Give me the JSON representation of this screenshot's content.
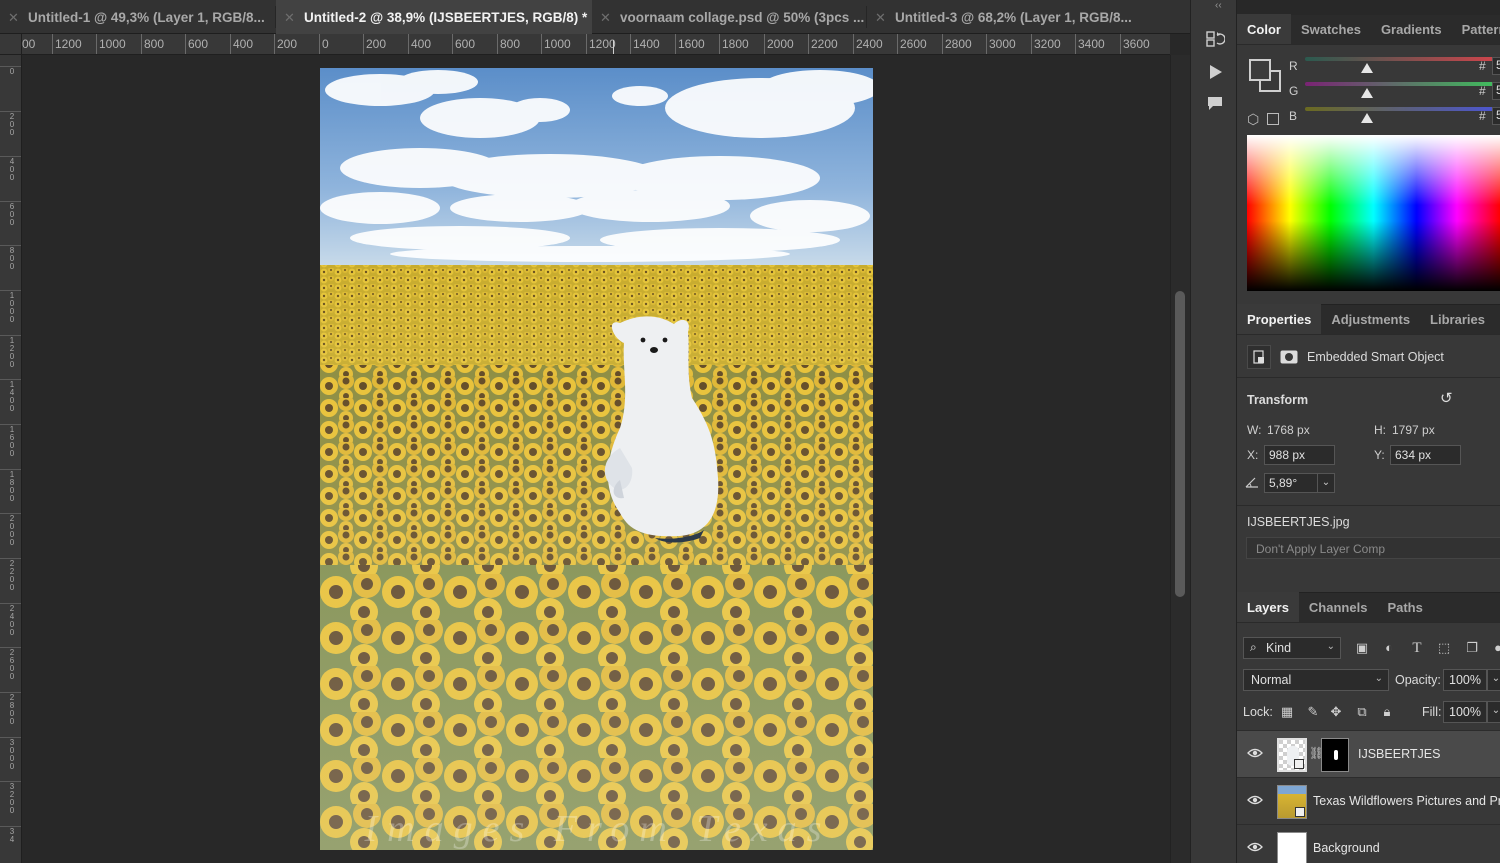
{
  "tabs": [
    {
      "label": "Untitled-1 @ 49,3% (Layer 1, RGB/8...",
      "active": false
    },
    {
      "label": "Untitled-2 @ 38,9% (IJSBEERTJES, RGB/8) *",
      "active": true
    },
    {
      "label": "voornaam collage.psd @ 50% (3pcs ...",
      "active": false
    },
    {
      "label": "Untitled-3 @ 68,2% (Layer 1, RGB/8...",
      "active": false
    }
  ],
  "ruler_top": [
    "00",
    "1200",
    "1000",
    "800",
    "600",
    "400",
    "200",
    "0",
    "200",
    "400",
    "600",
    "800",
    "1000",
    "1200",
    "1400",
    "1600",
    "1800",
    "2000",
    "2200",
    "2400",
    "2600",
    "2800",
    "3000",
    "3200",
    "3400",
    "3600"
  ],
  "ruler_left": [
    "0",
    "200",
    "400",
    "600",
    "800",
    "1000",
    "1200",
    "1400",
    "1600",
    "1800",
    "2000",
    "2200",
    "2400",
    "2600",
    "2800",
    "3000",
    "3200",
    "34"
  ],
  "canvas": {
    "watermark": "Images From Texas"
  },
  "color_panel": {
    "tabs": [
      "Color",
      "Swatches",
      "Gradients",
      "Patterns"
    ],
    "active_tab": "Color",
    "channels": [
      {
        "label": "R",
        "hex_symbol": "#",
        "value": "5"
      },
      {
        "label": "G",
        "hex_symbol": "#",
        "value": "5"
      },
      {
        "label": "B",
        "hex_symbol": "#",
        "value": "5"
      }
    ]
  },
  "properties": {
    "tabs": [
      "Properties",
      "Adjustments",
      "Libraries"
    ],
    "type_label": "Embedded Smart Object",
    "transform_heading": "Transform",
    "w_label": "W:",
    "w_value": "1768 px",
    "h_label": "H:",
    "h_value": "1797 px",
    "x_label": "X:",
    "x_value": "988 px",
    "y_label": "Y:",
    "y_value": "634 px",
    "angle_value": "5,89°",
    "filename": "IJSBEERTJES.jpg",
    "layer_comp": "Don't Apply Layer Comp"
  },
  "layers": {
    "tabs": [
      "Layers",
      "Channels",
      "Paths"
    ],
    "kind": "Kind",
    "blend_mode": "Normal",
    "opacity_label": "Opacity:",
    "opacity": "100%",
    "lock_label": "Lock:",
    "fill_label": "Fill:",
    "fill": "100%",
    "items": [
      {
        "name": "IJSBEERTJES",
        "selected": true
      },
      {
        "name": "Texas Wildflowers Pictures and Pr",
        "selected": false
      },
      {
        "name": "Background",
        "selected": false
      }
    ]
  },
  "colors": {
    "accent": "#1473e6",
    "panel_bg": "#383838",
    "app_bg": "#282828"
  }
}
